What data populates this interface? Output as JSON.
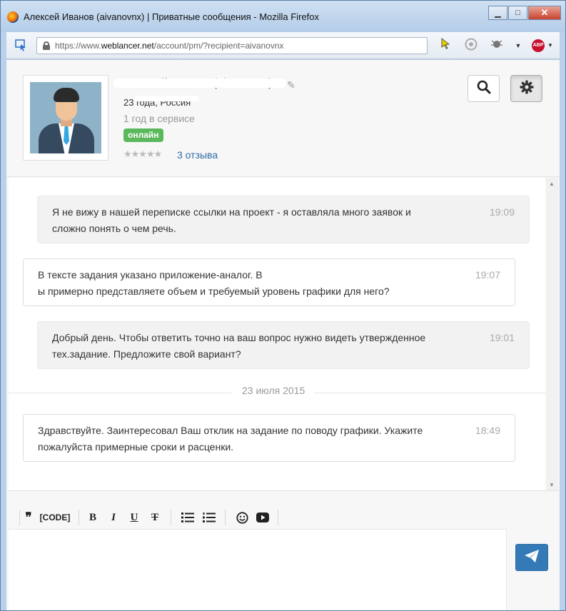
{
  "window": {
    "title": "Алексей Иванов (aivanovnx) | Приватные сообщения - Mozilla Firefox",
    "minimize": "▁",
    "maximize": "□",
    "close": "✕"
  },
  "navbar": {
    "url_prefix": "https://www.",
    "url_domain": "weblancer.net",
    "url_path": "/account/pm/?recipient=aivanovnx",
    "abp_label": "ABP"
  },
  "profile": {
    "name": "Алексей Иванов (aivanovnx)",
    "location": "23 года, Россия",
    "service": "1 год в сервисе",
    "status": "онлайн",
    "stars": "★★★★★",
    "reviews": "3 отзыва"
  },
  "messages": [
    {
      "side": "in",
      "text_lines": [
        "Я не вижу в нашей переписке ссылки на проект - я оставляла много заявок и",
        "сложно понять о чем речь."
      ],
      "time": "19:09"
    },
    {
      "side": "out",
      "text_lines": [
        "В тексте задания указано приложение-аналог. В",
        "ы примерно представляете объем и требуемый уровень графики для него?"
      ],
      "time": "19:07"
    },
    {
      "side": "in",
      "text_lines": [
        "Добрый день. Чтобы ответить точно на ваш вопрос нужно видеть утвержденное",
        "тех.задание. Предложите свой вариант?"
      ],
      "time": "19:01"
    },
    {
      "side": "out",
      "text_lines": [
        "Здравствуйте. Заинтересовал Ваш отклик на задание по поводу графики. Укажите",
        "пожалуйста примерные сроки и расценки."
      ],
      "time": "18:49"
    }
  ],
  "date_separator": "23 июля 2015",
  "toolbar": {
    "quote": "❞",
    "code": "[CODE]",
    "bold": "B",
    "italic": "I",
    "underline": "U",
    "strike": "T"
  },
  "icons": {
    "search": "search-icon",
    "settings": "gear-icon",
    "send": "paper-plane-icon",
    "edit": "pencil-icon"
  },
  "colors": {
    "link": "#2e6da4",
    "online": "#5cb85c",
    "send": "#337ab7"
  }
}
